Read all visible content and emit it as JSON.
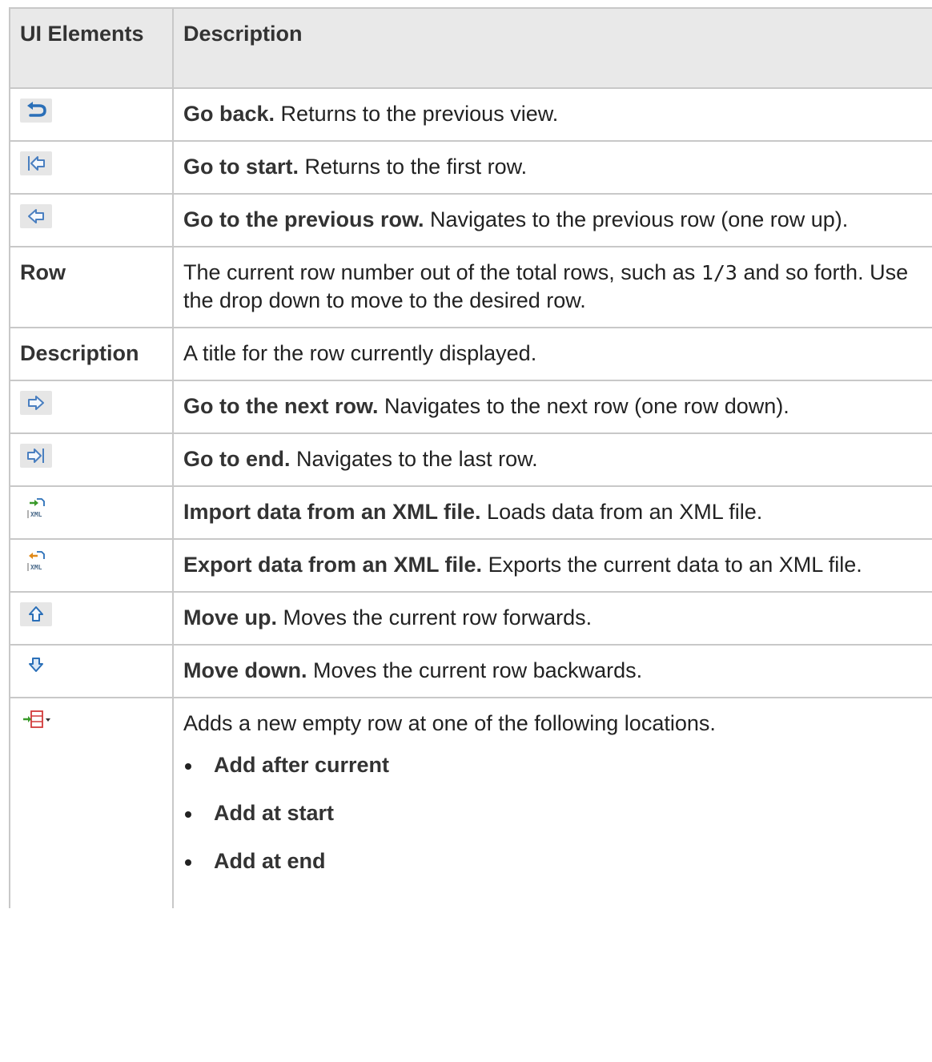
{
  "header": {
    "col1": "UI Elements",
    "col2": "Description"
  },
  "rows": [
    {
      "icon": "go-back-icon",
      "term": "Go back.",
      "desc": " Returns to the previous view."
    },
    {
      "icon": "go-to-start-icon",
      "term": "Go to start.",
      "desc": " Returns to the first row."
    },
    {
      "icon": "previous-row-icon",
      "term": "Go to the previous row.",
      "desc": " Navigates to the previous row (one row up)."
    },
    {
      "label": "Row",
      "desc_a": "The current row number out of the total rows, such as ",
      "code": "1/3",
      "desc_b": " and so forth. Use the drop down to move to the desired row."
    },
    {
      "label": "Description",
      "desc": "A title for the row currently displayed."
    },
    {
      "icon": "next-row-icon",
      "term": "Go to the next row.",
      "desc": " Navigates to the next row (one row down)."
    },
    {
      "icon": "go-to-end-icon",
      "term": "Go to end.",
      "desc": " Navigates to the last row."
    },
    {
      "icon": "import-xml-icon",
      "term": "Import data from an XML file.",
      "desc": " Loads data from an XML file."
    },
    {
      "icon": "export-xml-icon",
      "term": "Export data from an XML file.",
      "desc": " Exports the current data to an XML file."
    },
    {
      "icon": "move-up-icon",
      "term": "Move up.",
      "desc": " Moves the current row forwards."
    },
    {
      "icon": "move-down-icon",
      "term": "Move down.",
      "desc": " Moves the current row backwards."
    },
    {
      "icon": "add-row-dropdown-icon",
      "desc": "Adds a new empty row at one of the following locations.",
      "options": [
        "Add after current",
        "Add at start",
        "Add at end"
      ]
    }
  ],
  "icon_glyph_text": "XML",
  "colors": {
    "header_bg": "#e9e9e9",
    "border": "#c8c8c8",
    "icon_blue": "#2a6fb8",
    "icon_green": "#3a9a2a",
    "icon_orange": "#e08a1a",
    "icon_red": "#d23a3a"
  }
}
